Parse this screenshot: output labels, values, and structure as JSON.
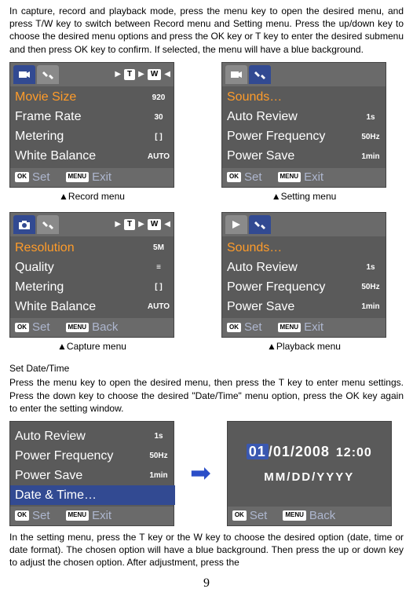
{
  "intro": "In capture, record and playback mode, press the menu key to open the desired menu, and press T/W key to switch between Record menu and Setting menu. Press the up/down key to choose the desired menu options and press the OK key or T key to enter the desired submenu and then press OK key to confirm. If selected, the menu will have a blue background.",
  "record_menu": {
    "items": [
      "Movie Size",
      "Frame Rate",
      "Metering",
      "White Balance"
    ],
    "vals": [
      "920",
      "30",
      "[ ]",
      "AUTO"
    ],
    "footer_set": "Set",
    "footer_exit": "Exit",
    "ok": "OK",
    "menu": "MENU",
    "tw_t": "T",
    "tw_w": "W",
    "caption": "▲Record menu"
  },
  "setting_menu": {
    "items": [
      "Sounds…",
      "Auto Review",
      "Power Frequency",
      "Power Save"
    ],
    "vals": [
      "",
      "1s",
      "50Hz",
      "1min"
    ],
    "footer_set": "Set",
    "footer_exit": "Exit",
    "ok": "OK",
    "menu": "MENU",
    "caption": "▲Setting menu"
  },
  "capture_menu": {
    "items": [
      "Resolution",
      "Quality",
      "Metering",
      "White Balance"
    ],
    "vals": [
      "5M",
      "≡",
      "[ ]",
      "AUTO"
    ],
    "footer_set": "Set",
    "footer_back": "Back",
    "ok": "OK",
    "menu": "MENU",
    "tw_t": "T",
    "tw_w": "W",
    "caption": "▲Capture menu"
  },
  "playback_menu": {
    "items": [
      "Sounds…",
      "Auto Review",
      "Power Frequency",
      "Power Save"
    ],
    "vals": [
      "",
      "1s",
      "50Hz",
      "1min"
    ],
    "footer_set": "Set",
    "footer_exit": "Exit",
    "ok": "OK",
    "menu": "MENU",
    "caption": "▲Playback menu"
  },
  "section2_title": "Set Date/Time",
  "section2_para": "Press the menu key to open the desired menu, then press the T key to enter menu settings. Press the down key to choose the desired \"Date/Time\" menu option, press the OK key again to enter the setting window.",
  "datetime_menu": {
    "items": [
      "Auto Review",
      "Power Frequency",
      "Power Save",
      "Date & Time…"
    ],
    "vals": [
      "1s",
      "50Hz",
      "1min",
      ""
    ],
    "highlight_index": 3,
    "footer_set": "Set",
    "footer_exit": "Exit",
    "ok": "OK",
    "menu": "MENU"
  },
  "date_window": {
    "month": "01",
    "rest_date": "/01/2008",
    "time": "12:00",
    "format": "MM/DD/YYYY",
    "footer_set": "Set",
    "footer_back": "Back",
    "ok": "OK",
    "menu": "MENU"
  },
  "closing": "In the setting menu, press the T key or the W key to choose the desired option (date, time or date format). The chosen option will have a blue background. Then press the up or down key to adjust the chosen option. After adjustment, press the",
  "page_number": "9"
}
